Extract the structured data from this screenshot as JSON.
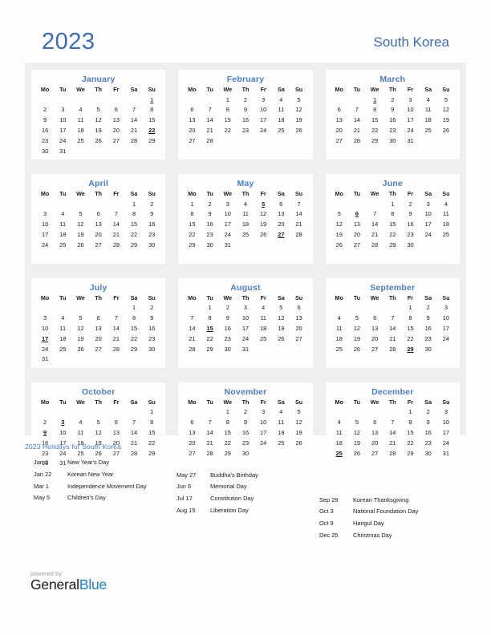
{
  "header": {
    "year": "2023",
    "country": "South Korea",
    "accent_color": "#3e6cb5"
  },
  "calendar": {
    "weekday_headers": [
      "Mo",
      "Tu",
      "We",
      "Th",
      "Fr",
      "Sa",
      "Su"
    ],
    "holiday_color": "#e2001a",
    "month_name_color": "#4a7ec4",
    "months": [
      {
        "name": "January",
        "weeks": [
          [
            "",
            "",
            "",
            "",
            "",
            "",
            "1"
          ],
          [
            "2",
            "3",
            "4",
            "5",
            "6",
            "7",
            "8"
          ],
          [
            "9",
            "10",
            "11",
            "12",
            "13",
            "14",
            "15"
          ],
          [
            "16",
            "17",
            "18",
            "19",
            "20",
            "21",
            "22"
          ],
          [
            "23",
            "24",
            "25",
            "26",
            "27",
            "28",
            "29"
          ],
          [
            "30",
            "31",
            "",
            "",
            "",
            "",
            ""
          ]
        ],
        "holidays": [
          "22"
        ],
        "marked": [
          "1"
        ]
      },
      {
        "name": "February",
        "weeks": [
          [
            "",
            "",
            "1",
            "2",
            "3",
            "4",
            "5"
          ],
          [
            "6",
            "7",
            "8",
            "9",
            "10",
            "11",
            "12"
          ],
          [
            "13",
            "14",
            "15",
            "16",
            "17",
            "18",
            "19"
          ],
          [
            "20",
            "21",
            "22",
            "23",
            "24",
            "25",
            "26"
          ],
          [
            "27",
            "28",
            "",
            "",
            "",
            "",
            ""
          ],
          [
            "",
            "",
            "",
            "",
            "",
            "",
            ""
          ]
        ],
        "holidays": [],
        "marked": []
      },
      {
        "name": "March",
        "weeks": [
          [
            "",
            "",
            "1",
            "2",
            "3",
            "4",
            "5"
          ],
          [
            "6",
            "7",
            "8",
            "9",
            "10",
            "11",
            "12"
          ],
          [
            "13",
            "14",
            "15",
            "16",
            "17",
            "18",
            "19"
          ],
          [
            "20",
            "21",
            "22",
            "23",
            "24",
            "25",
            "26"
          ],
          [
            "27",
            "28",
            "29",
            "30",
            "31",
            "",
            ""
          ],
          [
            "",
            "",
            "",
            "",
            "",
            "",
            ""
          ]
        ],
        "holidays": [],
        "marked": [
          "1"
        ]
      },
      {
        "name": "April",
        "weeks": [
          [
            "",
            "",
            "",
            "",
            "",
            "1",
            "2"
          ],
          [
            "3",
            "4",
            "5",
            "6",
            "7",
            "8",
            "9"
          ],
          [
            "10",
            "11",
            "12",
            "13",
            "14",
            "15",
            "16"
          ],
          [
            "17",
            "18",
            "19",
            "20",
            "21",
            "22",
            "23"
          ],
          [
            "24",
            "25",
            "26",
            "27",
            "28",
            "29",
            "30"
          ],
          [
            "",
            "",
            "",
            "",
            "",
            "",
            ""
          ]
        ],
        "holidays": [],
        "marked": []
      },
      {
        "name": "May",
        "weeks": [
          [
            "1",
            "2",
            "3",
            "4",
            "5",
            "6",
            "7"
          ],
          [
            "8",
            "9",
            "10",
            "11",
            "12",
            "13",
            "14"
          ],
          [
            "15",
            "16",
            "17",
            "18",
            "19",
            "20",
            "21"
          ],
          [
            "22",
            "23",
            "24",
            "25",
            "26",
            "27",
            "28"
          ],
          [
            "29",
            "30",
            "31",
            "",
            "",
            "",
            ""
          ],
          [
            "",
            "",
            "",
            "",
            "",
            "",
            ""
          ]
        ],
        "holidays": [
          "5",
          "27"
        ],
        "marked": []
      },
      {
        "name": "June",
        "weeks": [
          [
            "",
            "",
            "",
            "1",
            "2",
            "3",
            "4"
          ],
          [
            "5",
            "6",
            "7",
            "8",
            "9",
            "10",
            "11"
          ],
          [
            "12",
            "13",
            "14",
            "15",
            "16",
            "17",
            "18"
          ],
          [
            "19",
            "20",
            "21",
            "22",
            "23",
            "24",
            "25"
          ],
          [
            "26",
            "27",
            "28",
            "29",
            "30",
            "",
            ""
          ],
          [
            "",
            "",
            "",
            "",
            "",
            "",
            ""
          ]
        ],
        "holidays": [
          "6"
        ],
        "marked": []
      },
      {
        "name": "July",
        "weeks": [
          [
            "",
            "",
            "",
            "",
            "",
            "1",
            "2"
          ],
          [
            "3",
            "4",
            "5",
            "6",
            "7",
            "8",
            "9"
          ],
          [
            "10",
            "11",
            "12",
            "13",
            "14",
            "15",
            "16"
          ],
          [
            "17",
            "18",
            "19",
            "20",
            "21",
            "22",
            "23"
          ],
          [
            "24",
            "25",
            "26",
            "27",
            "28",
            "29",
            "30"
          ],
          [
            "31",
            "",
            "",
            "",
            "",
            "",
            ""
          ]
        ],
        "holidays": [
          "17"
        ],
        "marked": []
      },
      {
        "name": "August",
        "weeks": [
          [
            "",
            "1",
            "2",
            "3",
            "4",
            "5",
            "6"
          ],
          [
            "7",
            "8",
            "9",
            "10",
            "11",
            "12",
            "13"
          ],
          [
            "14",
            "15",
            "16",
            "17",
            "18",
            "19",
            "20"
          ],
          [
            "21",
            "22",
            "23",
            "24",
            "25",
            "26",
            "27"
          ],
          [
            "28",
            "29",
            "30",
            "31",
            "",
            "",
            ""
          ],
          [
            "",
            "",
            "",
            "",
            "",
            "",
            ""
          ]
        ],
        "holidays": [
          "15"
        ],
        "marked": []
      },
      {
        "name": "September",
        "weeks": [
          [
            "",
            "",
            "",
            "",
            "1",
            "2",
            "3"
          ],
          [
            "4",
            "5",
            "6",
            "7",
            "8",
            "9",
            "10"
          ],
          [
            "11",
            "12",
            "13",
            "14",
            "15",
            "16",
            "17"
          ],
          [
            "18",
            "19",
            "20",
            "21",
            "22",
            "23",
            "24"
          ],
          [
            "25",
            "26",
            "27",
            "28",
            "29",
            "30",
            ""
          ],
          [
            "",
            "",
            "",
            "",
            "",
            "",
            ""
          ]
        ],
        "holidays": [
          "29"
        ],
        "marked": []
      },
      {
        "name": "October",
        "weeks": [
          [
            "",
            "",
            "",
            "",
            "",
            "",
            "1"
          ],
          [
            "2",
            "3",
            "4",
            "5",
            "6",
            "7",
            "8"
          ],
          [
            "9",
            "10",
            "11",
            "12",
            "13",
            "14",
            "15"
          ],
          [
            "16",
            "17",
            "18",
            "19",
            "20",
            "21",
            "22"
          ],
          [
            "23",
            "24",
            "25",
            "26",
            "27",
            "28",
            "29"
          ],
          [
            "30",
            "31",
            "",
            "",
            "",
            "",
            ""
          ]
        ],
        "holidays": [
          "3",
          "9"
        ],
        "marked": []
      },
      {
        "name": "November",
        "weeks": [
          [
            "",
            "",
            "1",
            "2",
            "3",
            "4",
            "5"
          ],
          [
            "6",
            "7",
            "8",
            "9",
            "10",
            "11",
            "12"
          ],
          [
            "13",
            "14",
            "15",
            "16",
            "17",
            "18",
            "19"
          ],
          [
            "20",
            "21",
            "22",
            "23",
            "24",
            "25",
            "26"
          ],
          [
            "27",
            "28",
            "29",
            "30",
            "",
            "",
            ""
          ],
          [
            "",
            "",
            "",
            "",
            "",
            "",
            ""
          ]
        ],
        "holidays": [],
        "marked": []
      },
      {
        "name": "December",
        "weeks": [
          [
            "",
            "",
            "",
            "",
            "1",
            "2",
            "3"
          ],
          [
            "4",
            "5",
            "6",
            "7",
            "8",
            "9",
            "10"
          ],
          [
            "11",
            "12",
            "13",
            "14",
            "15",
            "16",
            "17"
          ],
          [
            "18",
            "19",
            "20",
            "21",
            "22",
            "23",
            "24"
          ],
          [
            "25",
            "26",
            "27",
            "28",
            "29",
            "30",
            "31"
          ],
          [
            "",
            "",
            "",
            "",
            "",
            "",
            ""
          ]
        ],
        "holidays": [
          "25"
        ],
        "marked": []
      }
    ]
  },
  "holidays_legend": {
    "heading": "2023 Holidays for South Korea",
    "columns": [
      [
        {
          "date": "Jan 1",
          "name": "New Year's Day"
        },
        {
          "date": "Jan 22",
          "name": "Korean New Year"
        },
        {
          "date": "Mar 1",
          "name": "Independence Movement Day"
        },
        {
          "date": "May 5",
          "name": "Children's Day"
        }
      ],
      [
        {
          "date": "May 27",
          "name": "Buddha's Birthday"
        },
        {
          "date": "Jun 6",
          "name": "Memorial Day"
        },
        {
          "date": "Jul 17",
          "name": "Constitution Day"
        },
        {
          "date": "Aug 15",
          "name": "Liberation Day"
        }
      ],
      [
        {
          "date": "Sep 29",
          "name": "Korean Thanksgiving"
        },
        {
          "date": "Oct 3",
          "name": "National Foundation Day"
        },
        {
          "date": "Oct 9",
          "name": "Hangul Day"
        },
        {
          "date": "Dec 25",
          "name": "Christmas Day"
        }
      ]
    ]
  },
  "footer": {
    "powered_by": "powered by",
    "brand_part1": "General",
    "brand_part2": "Blue",
    "brand_part2_color": "#1f7fd4"
  }
}
